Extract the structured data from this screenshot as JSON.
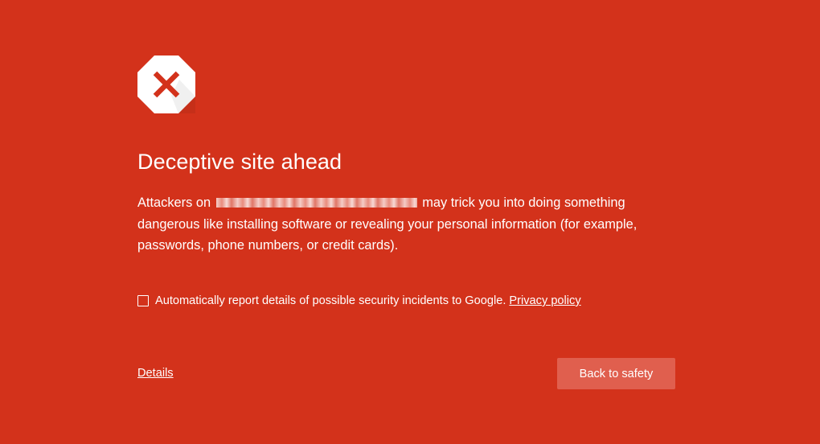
{
  "icon": "deceptive-site-octagon-x-icon",
  "colors": {
    "background": "#d3321b",
    "button": "#e05f4e",
    "icon_x": "#d3321b"
  },
  "heading": "Deceptive site ahead",
  "message": {
    "prefix": "Attackers on",
    "suffix": "may trick you into doing something dangerous like installing software or revealing your personal information (for example, passwords, phone numbers, or credit cards)."
  },
  "report": {
    "checked": false,
    "label": "Automatically report details of possible security incidents to Google.",
    "privacy_link": "Privacy policy"
  },
  "details_link": "Details",
  "back_button": "Back to safety"
}
